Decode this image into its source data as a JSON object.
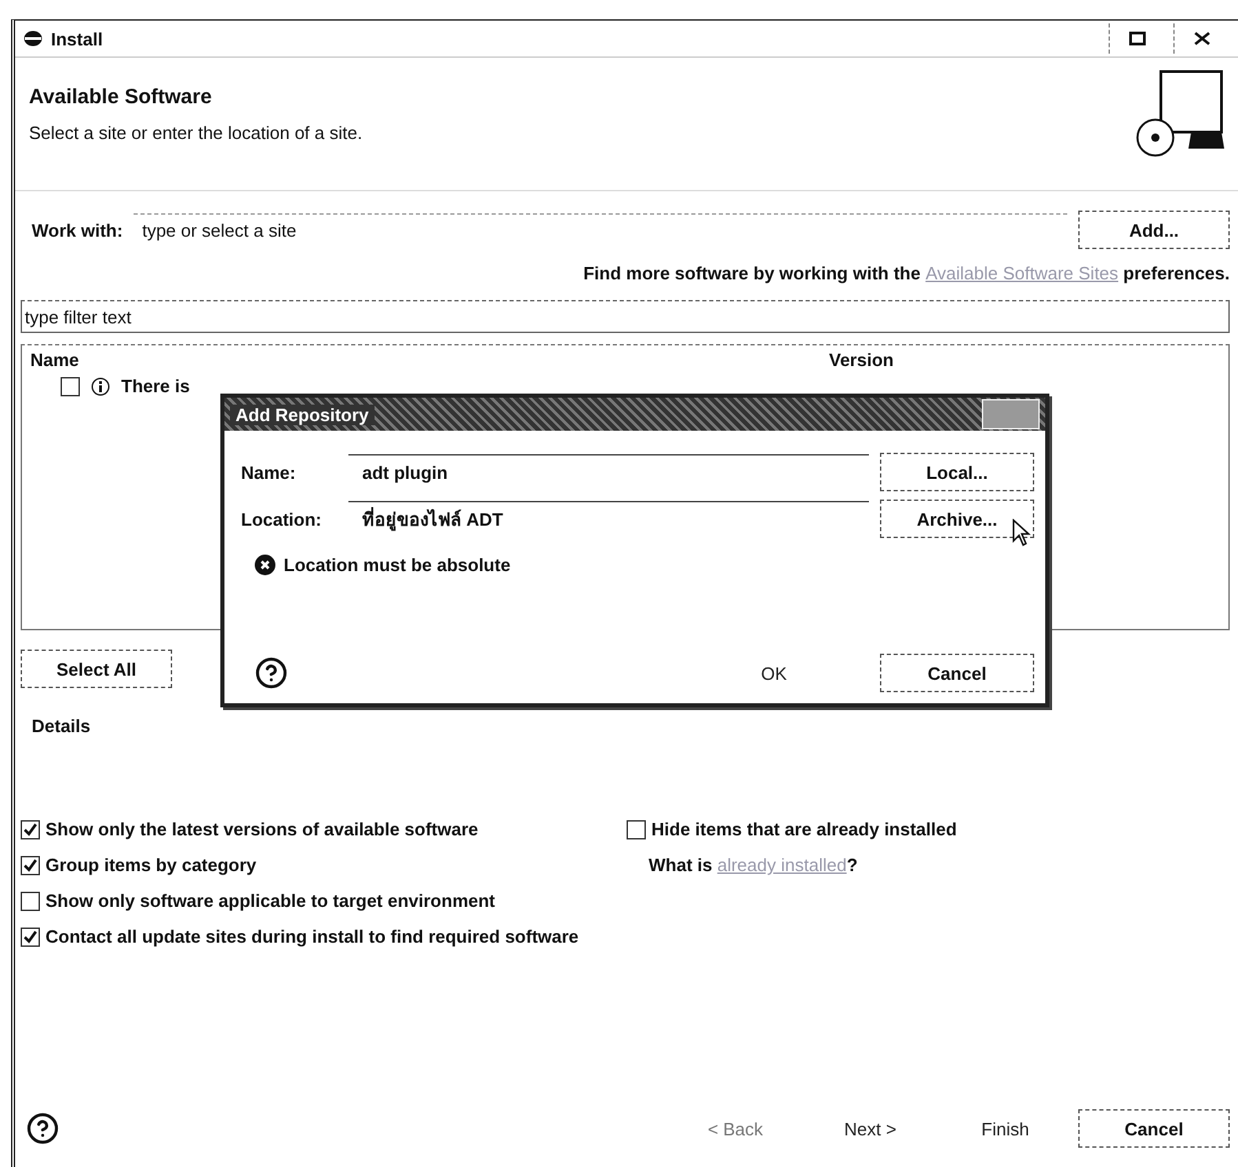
{
  "window": {
    "title": "Install"
  },
  "header": {
    "title": "Available Software",
    "subtitle": "Select a site or enter the location of a site."
  },
  "work_with": {
    "label": "Work with:",
    "value": "type or select a site",
    "button": "Add..."
  },
  "find_more": {
    "before": "Find more software by working with the",
    "link": "Available Software Sites",
    "after": "preferences."
  },
  "filter": {
    "value": "type filter text"
  },
  "table": {
    "columns": [
      "Name",
      "Version"
    ],
    "rows": [
      {
        "text": "There is",
        "checked": false
      }
    ]
  },
  "select_all": "Select All",
  "details": {
    "label": "Details"
  },
  "options_left": [
    {
      "label": "Show only the latest versions of available software",
      "checked": true
    },
    {
      "label": "Group items by category",
      "checked": true
    },
    {
      "label": "Show only software applicable to target environment",
      "checked": false
    },
    {
      "label": "Contact all update sites during install to find required software",
      "checked": true
    }
  ],
  "options_right": [
    {
      "label": "Hide items that are already installed",
      "checked": false
    }
  ],
  "installed_note": {
    "before": "What is",
    "link": "already installed",
    "after": "?"
  },
  "footer_buttons": [
    {
      "label": "< Back",
      "disabled": true
    },
    {
      "label": "Next >",
      "disabled": false
    },
    {
      "label": "Finish",
      "disabled": false
    },
    {
      "label": "Cancel",
      "disabled": false
    }
  ],
  "dialog": {
    "title": "Add Repository",
    "fields": [
      {
        "label": "Name:",
        "value": "adt plugin",
        "button": "Local..."
      },
      {
        "label": "Location:",
        "value": "ที่อยู่ของไฟล์ ADT",
        "button": "Archive..."
      }
    ],
    "error": "Location must be absolute",
    "buttons": [
      "OK",
      "Cancel"
    ]
  }
}
